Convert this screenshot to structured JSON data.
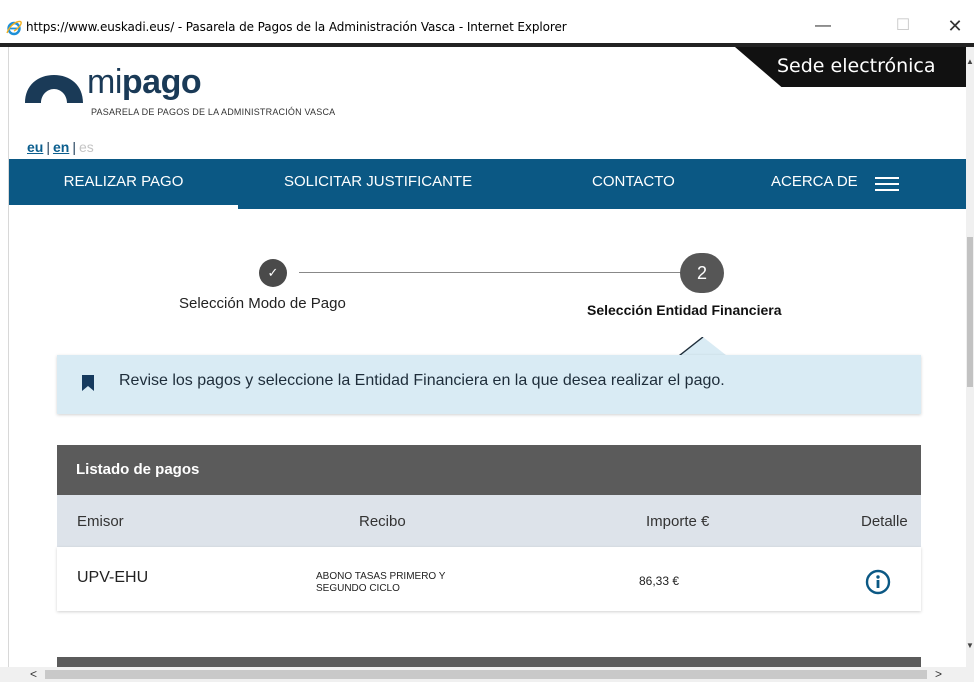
{
  "window": {
    "title": "https://www.euskadi.eus/ - Pasarela de Pagos de la Administración Vasca - Internet Explorer",
    "minimize": "—",
    "maximize": "☐",
    "close": "✕"
  },
  "header": {
    "logo_thin": "mi",
    "logo_bold": "pago",
    "logo_subtitle": "PASARELA DE PAGOS DE LA ADMINISTRACIÓN VASCA",
    "sede": "Sede electrónica"
  },
  "languages": {
    "eu": "eu",
    "en": "en",
    "es": "es",
    "separator": "|"
  },
  "nav": {
    "items": [
      {
        "label": "REALIZAR PAGO"
      },
      {
        "label": "SOLICITAR JUSTIFICANTE"
      },
      {
        "label": "CONTACTO"
      },
      {
        "label": "ACERCA DE"
      }
    ]
  },
  "stepper": {
    "step1_symbol": "✓",
    "step1_label": "Selección Modo de Pago",
    "step2_number": "2",
    "step2_label": "Selección Entidad Financiera"
  },
  "notice": {
    "text": "Revise los pagos y seleccione la Entidad Financiera en la que desea realizar el pago."
  },
  "table": {
    "title": "Listado de pagos",
    "columns": {
      "emisor": "Emisor",
      "recibo": "Recibo",
      "importe": "Importe €",
      "detalle": "Detalle"
    },
    "rows": [
      {
        "emisor": "UPV-EHU",
        "recibo": "ABONO TASAS PRIMERO Y SEGUNDO CICLO",
        "importe": "86,33 €",
        "detalle_icon": "info-icon"
      }
    ]
  },
  "colors": {
    "nav_bg": "#0b5884",
    "logo_navy": "#1a3a57",
    "notice_bg": "#d9ebf4",
    "table_head_bg": "#5b5b5b",
    "table_cols_bg": "#dde3ea",
    "info_icon": "#0b5884"
  }
}
